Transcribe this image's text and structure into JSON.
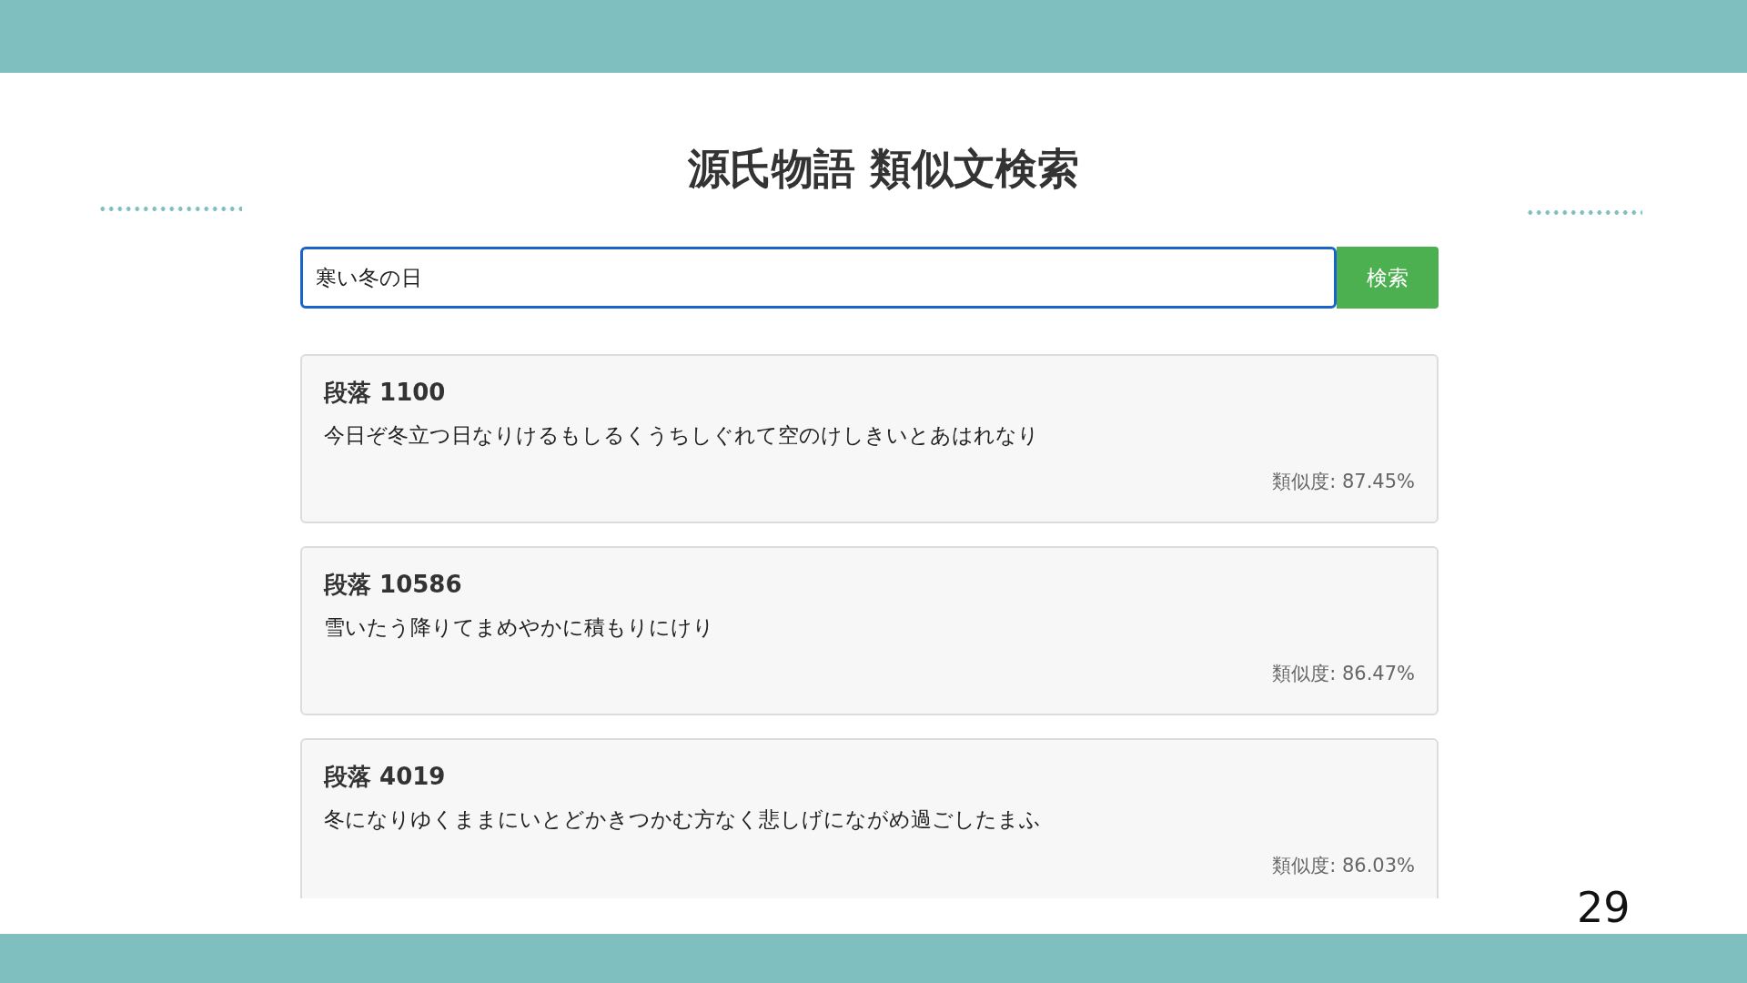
{
  "title": "源氏物語 類似文検索",
  "search": {
    "value": "寒い冬の日",
    "button": "検索"
  },
  "results": [
    {
      "heading": "段落 1100",
      "text": "今日ぞ冬立つ日なりけるもしるくうちしぐれて空のけしきいとあはれなり",
      "similarity": "類似度: 87.45%"
    },
    {
      "heading": "段落 10586",
      "text": "雪いたう降りてまめやかに積もりにけり",
      "similarity": "類似度: 86.47%"
    },
    {
      "heading": "段落 4019",
      "text": "冬になりゆくままにいとどかきつかむ方なく悲しげにながめ過ごしたまふ",
      "similarity": "類似度: 86.03%"
    }
  ],
  "page_number": "29"
}
